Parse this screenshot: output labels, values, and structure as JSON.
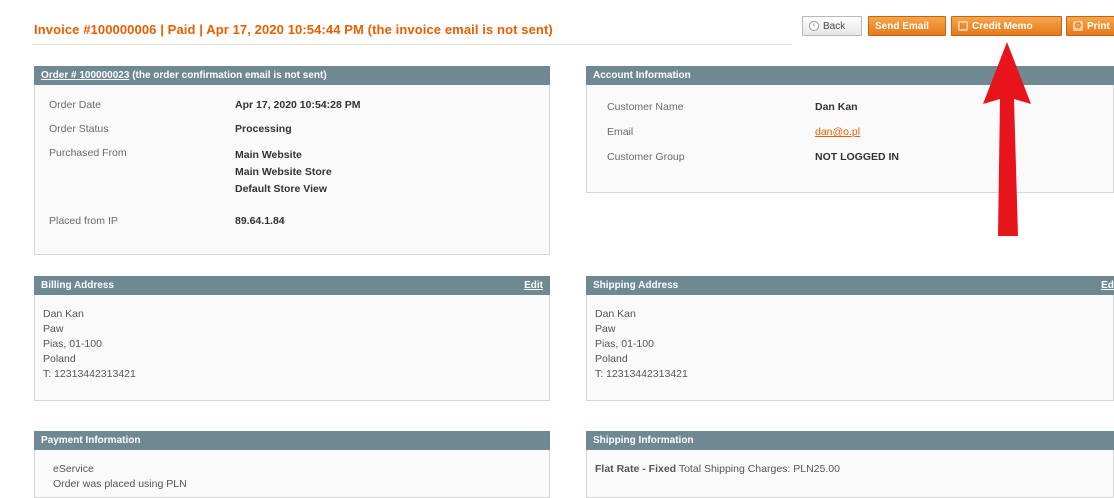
{
  "header": {
    "title": "Invoice #100000006 | Paid | Apr 17, 2020 10:54:44 PM (the invoice email is not sent)"
  },
  "toolbar": {
    "back_label": "Back",
    "send_email_label": "Send Email",
    "credit_memo_label": "Credit Memo",
    "print_label": "Print"
  },
  "order": {
    "header_link": "Order # 100000023",
    "header_note": "(the order confirmation email is not sent)",
    "date_label": "Order Date",
    "date_value": "Apr 17, 2020 10:54:28 PM",
    "status_label": "Order Status",
    "status_value": "Processing",
    "purchased_label": "Purchased From",
    "purchased_values": [
      "Main Website",
      "Main Website Store",
      "Default Store View"
    ],
    "ip_label": "Placed from IP",
    "ip_value": "89.64.1.84"
  },
  "account": {
    "header": "Account Information",
    "name_label": "Customer Name",
    "name_value": "Dan Kan",
    "email_label": "Email",
    "email_value": "dan@o.pl",
    "group_label": "Customer Group",
    "group_value": "NOT LOGGED IN"
  },
  "billing": {
    "header": "Billing Address",
    "edit_label": "Edit",
    "lines": [
      "Dan Kan",
      "Paw",
      "Pias, 01-100",
      "Poland",
      "T: 12313442313421"
    ]
  },
  "shipping_address": {
    "header": "Shipping Address",
    "edit_label": "Edit",
    "lines": [
      "Dan Kan",
      "Paw",
      "Pias, 01-100",
      "Poland",
      "T: 12313442313421"
    ]
  },
  "payment": {
    "header": "Payment Information",
    "lines": [
      "eService",
      "Order was placed using PLN"
    ]
  },
  "shipping_info": {
    "header": "Shipping Information",
    "method": "Flat Rate - Fixed",
    "charges": "Total Shipping Charges: PLN25.00"
  },
  "colors": {
    "accent": "#eb5e00",
    "button": "#e5791a",
    "section_header": "#6f8992",
    "annotation_arrow": "#e8141b"
  },
  "icons": {
    "back": "back-circle-icon",
    "credit_memo": "credit-memo-icon",
    "print": "print-icon",
    "annotation": "red-arrow-up-icon"
  }
}
